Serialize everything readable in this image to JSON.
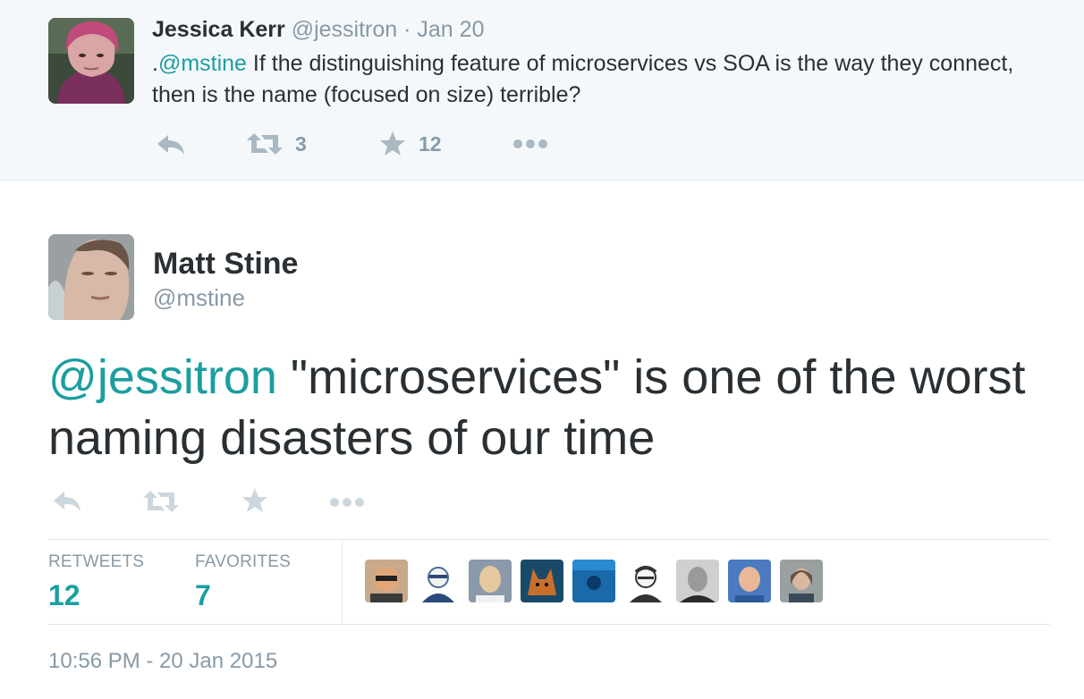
{
  "reply_tweet": {
    "name": "Jessica Kerr",
    "handle": "@jessitron",
    "separator": "·",
    "date": "Jan 20",
    "text_prefix": ".",
    "mention": "@mstine",
    "text": " If the distinguishing feature of microservices vs SOA is the way they connect, then is the name (focused on size) terrible?",
    "actions": {
      "reply_icon": "reply-icon",
      "retweet_icon": "retweet-icon",
      "retweet_count": "3",
      "favorite_icon": "star-icon",
      "favorite_count": "12",
      "more_icon": "more-icon"
    }
  },
  "main_tweet": {
    "name": "Matt Stine",
    "handle": "@mstine",
    "mention": "@jessitron",
    "text": " \"microservices\" is one of the worst naming disasters of our time",
    "actions": {
      "reply_icon": "reply-icon",
      "retweet_icon": "retweet-icon",
      "favorite_icon": "star-icon",
      "more_icon": "more-icon"
    },
    "stats": {
      "retweets_label": "RETWEETS",
      "retweets_value": "12",
      "favorites_label": "FAVORITES",
      "favorites_value": "7"
    },
    "favoriters_count": 9,
    "timestamp": "10:56 PM - 20 Jan 2015"
  },
  "colors": {
    "accent": "#1b9ea0",
    "muted": "#8899a6",
    "text": "#292f33",
    "reply_bg": "#f5f8fa",
    "border": "#e1e8ed"
  }
}
